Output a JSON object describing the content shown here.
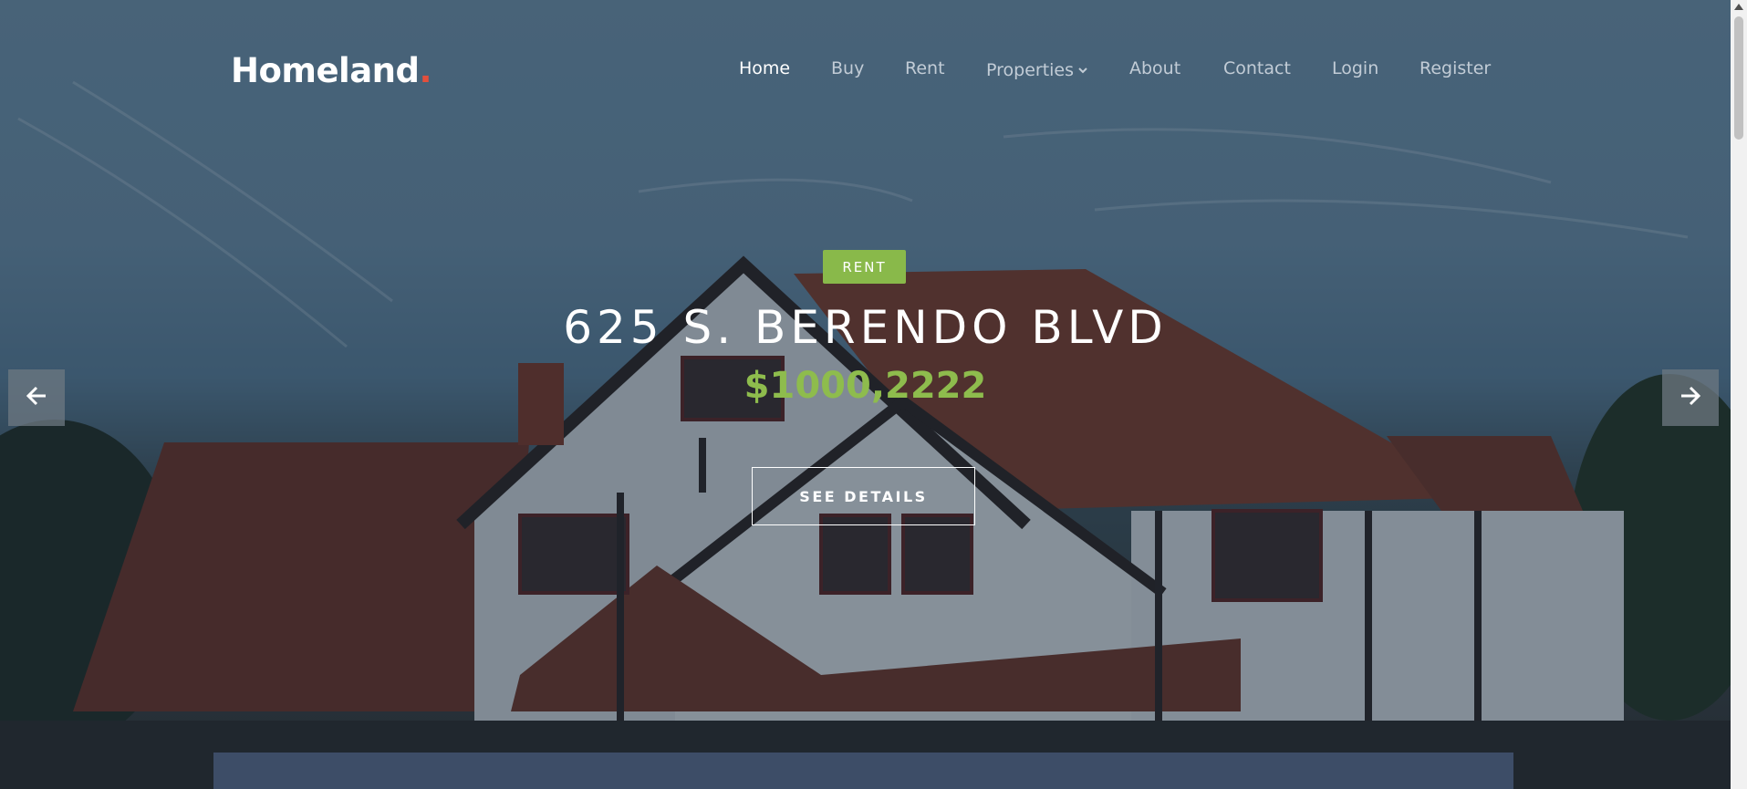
{
  "brand": {
    "name": "Homeland",
    "dot": "."
  },
  "nav": {
    "items": [
      {
        "label": "Home",
        "active": true
      },
      {
        "label": "Buy"
      },
      {
        "label": "Rent"
      },
      {
        "label": "Properties",
        "dropdown": true
      },
      {
        "label": "About"
      },
      {
        "label": "Contact"
      },
      {
        "label": "Login"
      },
      {
        "label": "Register"
      }
    ]
  },
  "hero": {
    "badge": "RENT",
    "title": "625 S. BERENDO BLVD",
    "price": "$1000,2222",
    "button": "SEE DETAILS"
  },
  "icons": {
    "prev": "arrow-left-icon",
    "next": "arrow-right-icon",
    "dropdown": "chevron-down-icon"
  },
  "colors": {
    "accent_green": "#89b94a",
    "price_green": "#8ebc4d",
    "logo_dot": "#e44f3c",
    "panel": "#3d4d67"
  }
}
